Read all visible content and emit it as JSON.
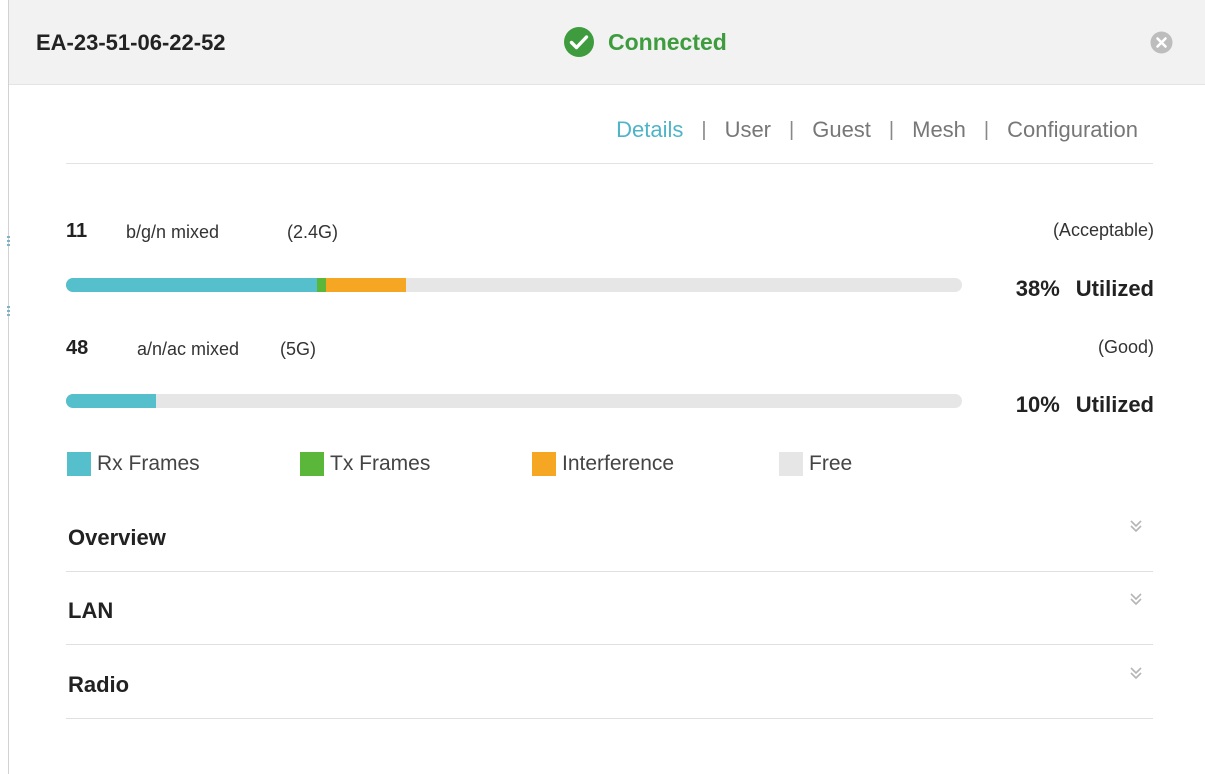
{
  "header": {
    "device_name": "EA-23-51-06-22-52",
    "status": "Connected",
    "status_icon": "check-circle-icon",
    "close_icon": "close-circle-icon"
  },
  "tabs": [
    {
      "label": "Details",
      "active": true
    },
    {
      "label": "User",
      "active": false
    },
    {
      "label": "Guest",
      "active": false
    },
    {
      "label": "Mesh",
      "active": false
    },
    {
      "label": "Configuration",
      "active": false
    }
  ],
  "tab_separator": "|",
  "channels": [
    {
      "channel": "11",
      "mode": "b/g/n mixed",
      "band": "(2.4G)",
      "quality": "(Acceptable)",
      "utilization": "38%",
      "utilized_label": "Utilized",
      "bar": {
        "rx": 28,
        "tx": 1,
        "interference": 9
      }
    },
    {
      "channel": "48",
      "mode": "a/n/ac mixed",
      "band": "(5G)",
      "quality": "(Good)",
      "utilization": "10%",
      "utilized_label": "Utilized",
      "bar": {
        "rx": 10,
        "tx": 0,
        "interference": 0
      }
    }
  ],
  "legend": [
    {
      "label": "Rx Frames",
      "color": "#55bfcc"
    },
    {
      "label": "Tx Frames",
      "color": "#5ab73a"
    },
    {
      "label": "Interference",
      "color": "#f5a623"
    },
    {
      "label": "Free",
      "color": "#e6e6e6"
    }
  ],
  "sections": [
    {
      "title": "Overview",
      "icon": "double-chevron-down-icon"
    },
    {
      "title": "LAN",
      "icon": "double-chevron-down-icon"
    },
    {
      "title": "Radio",
      "icon": "double-chevron-down-icon"
    }
  ],
  "colors": {
    "accent": "#4fb4c8",
    "connected": "#3e9c3e",
    "rx": "#55bfcc",
    "tx": "#5ab73a",
    "interference": "#f5a623",
    "free": "#e6e6e6"
  }
}
